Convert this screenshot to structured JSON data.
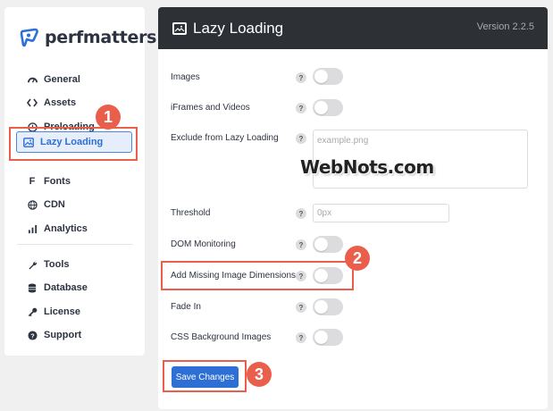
{
  "brand": {
    "name": "perfmatters"
  },
  "sidebar": {
    "items": [
      {
        "label": "General",
        "icon": "dashboard-icon"
      },
      {
        "label": "Assets",
        "icon": "code-icon"
      },
      {
        "label": "Preloading",
        "icon": "clock-icon"
      },
      {
        "label": "Lazy Loading",
        "icon": "image-icon",
        "active": true
      },
      {
        "label": "Fonts",
        "icon": "font-icon"
      },
      {
        "label": "CDN",
        "icon": "globe-icon"
      },
      {
        "label": "Analytics",
        "icon": "bar-chart-icon"
      },
      {
        "label": "Tools",
        "icon": "wrench-icon"
      },
      {
        "label": "Database",
        "icon": "database-icon"
      },
      {
        "label": "License",
        "icon": "key-icon"
      },
      {
        "label": "Support",
        "icon": "question-circle-icon"
      }
    ]
  },
  "header": {
    "title": "Lazy Loading",
    "version": "Version 2.2.5"
  },
  "settings": {
    "images": "Images",
    "iframes": "iFrames and Videos",
    "exclude": "Exclude from Lazy Loading",
    "exclude_placeholder": "example.png",
    "threshold": "Threshold",
    "threshold_placeholder": "0px",
    "dom_monitoring": "DOM Monitoring",
    "add_missing_dims": "Add Missing Image Dimensions",
    "fade_in": "Fade In",
    "css_bg_images": "CSS Background Images",
    "help_glyph": "?"
  },
  "save_label": "Save Changes",
  "annotations": {
    "badge1": "1",
    "badge2": "2",
    "badge3": "3"
  },
  "watermark": "WebNots.com",
  "colors": {
    "accent": "#2d6fd4",
    "header": "#2d3136",
    "annotation": "#e95f4c"
  }
}
